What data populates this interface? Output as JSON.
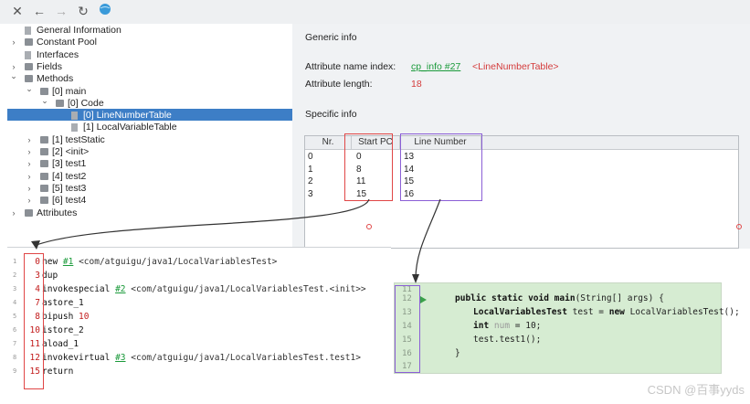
{
  "tree": {
    "items": [
      {
        "label": "General Information",
        "depth": 0,
        "twisty": "",
        "icon": "file"
      },
      {
        "label": "Constant Pool",
        "depth": 0,
        "twisty": ">",
        "icon": "folder"
      },
      {
        "label": "Interfaces",
        "depth": 0,
        "twisty": "",
        "icon": "file"
      },
      {
        "label": "Fields",
        "depth": 0,
        "twisty": ">",
        "icon": "folder"
      },
      {
        "label": "Methods",
        "depth": 0,
        "twisty": "v",
        "icon": "folder"
      },
      {
        "label": "[0] main",
        "depth": 1,
        "twisty": "v",
        "icon": "folder"
      },
      {
        "label": "[0] Code",
        "depth": 2,
        "twisty": "v",
        "icon": "folder"
      },
      {
        "label": "[0] LineNumberTable",
        "depth": 3,
        "twisty": "",
        "icon": "file"
      },
      {
        "label": "[1] LocalVariableTable",
        "depth": 3,
        "twisty": "",
        "icon": "file"
      },
      {
        "label": "[1] testStatic",
        "depth": 1,
        "twisty": ">",
        "icon": "folder"
      },
      {
        "label": "[2] <init>",
        "depth": 1,
        "twisty": ">",
        "icon": "folder"
      },
      {
        "label": "[3] test1",
        "depth": 1,
        "twisty": ">",
        "icon": "folder"
      },
      {
        "label": "[4] test2",
        "depth": 1,
        "twisty": ">",
        "icon": "folder"
      },
      {
        "label": "[5] test3",
        "depth": 1,
        "twisty": ">",
        "icon": "folder"
      },
      {
        "label": "[6] test4",
        "depth": 1,
        "twisty": ">",
        "icon": "folder"
      },
      {
        "label": "Attributes",
        "depth": 0,
        "twisty": ">",
        "icon": "folder"
      }
    ]
  },
  "info": {
    "generic_heading": "Generic info",
    "attr_name_label": "Attribute name index:",
    "attr_name_link": "cp_info #27",
    "attr_name_value": "<LineNumberTable>",
    "attr_len_label": "Attribute length:",
    "attr_len_value": "18",
    "specific_heading": "Specific info"
  },
  "table": {
    "headers": [
      "Nr.",
      "Start PC",
      "Line Number"
    ],
    "rows": [
      [
        "0",
        "0",
        "13"
      ],
      [
        "1",
        "8",
        "14"
      ],
      [
        "2",
        "11",
        "15"
      ],
      [
        "3",
        "15",
        "16"
      ]
    ]
  },
  "bytecode": [
    {
      "ln": "1",
      "off": "0",
      "op": "new ",
      "ref": "#1",
      "rest": " <com/atguigu/java1/LocalVariablesTest>"
    },
    {
      "ln": "2",
      "off": "3",
      "op": "dup",
      "ref": "",
      "rest": ""
    },
    {
      "ln": "3",
      "off": "4",
      "op": "invokespecial ",
      "ref": "#2",
      "rest": " <com/atguigu/java1/LocalVariablesTest.<init>>"
    },
    {
      "ln": "4",
      "off": "7",
      "op": "astore_1",
      "ref": "",
      "rest": ""
    },
    {
      "ln": "5",
      "off": "8",
      "op": "bipush ",
      "ref": "",
      "rest": "",
      "num": "10"
    },
    {
      "ln": "6",
      "off": "10",
      "op": "istore_2",
      "ref": "",
      "rest": ""
    },
    {
      "ln": "7",
      "off": "11",
      "op": "aload_1",
      "ref": "",
      "rest": ""
    },
    {
      "ln": "8",
      "off": "12",
      "op": "invokevirtual ",
      "ref": "#3",
      "rest": " <com/atguigu/java1/LocalVariablesTest.test1>"
    },
    {
      "ln": "9",
      "off": "15",
      "op": "return",
      "ref": "",
      "rest": ""
    }
  ],
  "editor": {
    "line_numbers": [
      "11",
      "12",
      "13",
      "14",
      "15",
      "16",
      "17"
    ],
    "line12": {
      "kw": "public static void ",
      "nm": "main",
      "rest": "(String[] args) {"
    },
    "line13": {
      "cls": "LocalVariablesTest",
      "rest": " test = ",
      "kw": "new",
      "rest2": " LocalVariablesTest();"
    },
    "line14": {
      "kw": "int",
      "var": " num",
      "rest": " = 10;"
    },
    "line15": {
      "text": "test.test1();"
    },
    "line16": {
      "text": "}"
    }
  },
  "watermark": "CSDN @百事yyds",
  "colors": {
    "link": "#1a9a3a",
    "value_red": "#d43b3b",
    "box_red": "#e04646",
    "box_purple": "#8b5fd6",
    "selection": "#3d7ec6",
    "editor_bg": "#d6ecd2"
  }
}
